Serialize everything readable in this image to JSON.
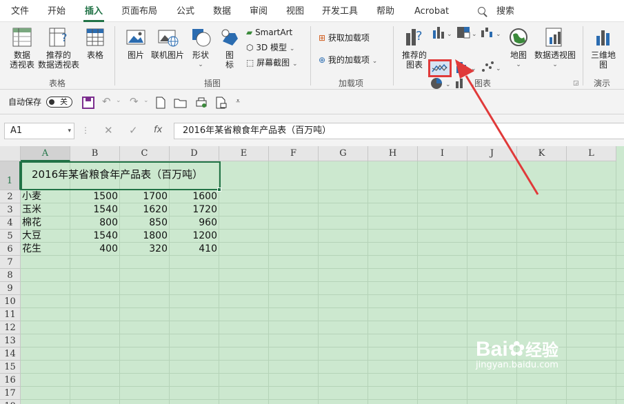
{
  "menu": {
    "tabs": [
      "文件",
      "开始",
      "插入",
      "页面布局",
      "公式",
      "数据",
      "审阅",
      "视图",
      "开发工具",
      "帮助",
      "Acrobat"
    ],
    "active_tab": "插入",
    "search_label": "搜索"
  },
  "ribbon": {
    "tables": {
      "pivot_l1": "数据",
      "pivot_l2": "透视表",
      "recpivot_l1": "推荐的",
      "recpivot_l2": "数据透视表",
      "table": "表格",
      "group": "表格"
    },
    "illustrations": {
      "pictures": "图片",
      "online_pictures": "联机图片",
      "shapes": "形状",
      "icons_l1": "图",
      "icons_l2": "标",
      "smartart": "SmartArt",
      "model3d": "3D 模型",
      "screenshot": "屏幕截图",
      "group": "插图"
    },
    "addins": {
      "get": "获取加载项",
      "my": "我的加载项",
      "group": "加载项"
    },
    "charts": {
      "recommended_l1": "推荐的",
      "recommended_l2": "图表",
      "maps": "地图",
      "pivotchart": "数据透视图",
      "group": "图表"
    },
    "tours": {
      "map3d_l1": "三维地",
      "map3d_l2": "图",
      "group": "演示"
    }
  },
  "qat": {
    "autosave_label": "自动保存",
    "autosave_state": "关"
  },
  "formula_bar": {
    "name_box": "A1",
    "fx": "fx",
    "content": "2016年某省粮食年产品表（百万吨）"
  },
  "sheet": {
    "columns": [
      "A",
      "B",
      "C",
      "D",
      "E",
      "F",
      "G",
      "H",
      "I",
      "J",
      "K",
      "L"
    ],
    "rows": [
      "1",
      "2",
      "3",
      "4",
      "5",
      "6",
      "7",
      "8",
      "9",
      "10",
      "11",
      "12",
      "13",
      "14",
      "15",
      "16",
      "17",
      "18"
    ],
    "title": "2016年某省粮食年产品表（百万吨）",
    "data": [
      [
        "小麦",
        "1500",
        "1700",
        "1600"
      ],
      [
        "玉米",
        "1540",
        "1620",
        "1720"
      ],
      [
        "棉花",
        "800",
        "850",
        "960"
      ],
      [
        "大豆",
        "1540",
        "1800",
        "1200"
      ],
      [
        "花生",
        "400",
        "320",
        "410"
      ]
    ]
  },
  "watermark": {
    "brand_a": "Bai",
    "brand_b": "经验",
    "url": "jingyan.baidu.com"
  },
  "colors": {
    "accent": "#217346",
    "highlight": "#e03a3a",
    "sheet_bg": "#cce8cf"
  }
}
